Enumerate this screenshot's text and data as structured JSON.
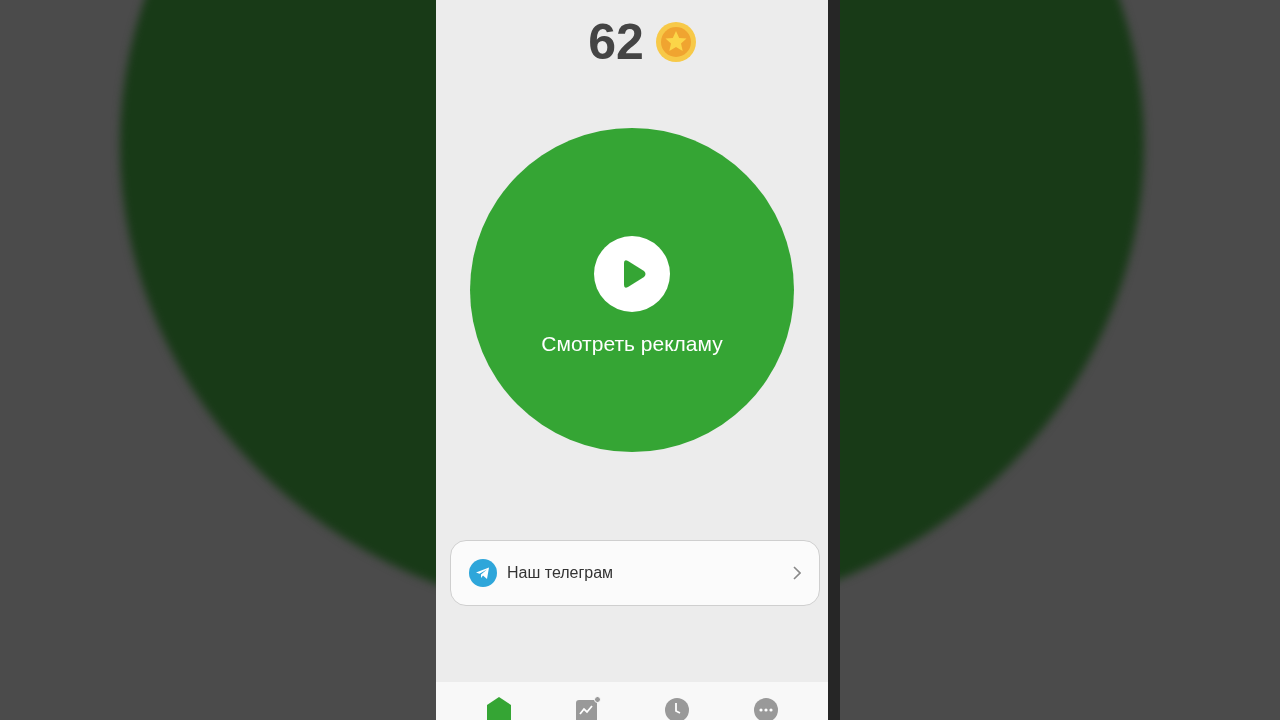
{
  "score": {
    "value": "62"
  },
  "ad_button": {
    "label": "Смотреть рекламу"
  },
  "links": [
    {
      "label": "Наш телеграм"
    }
  ],
  "nav": [
    {
      "kind": "home",
      "selected": true,
      "badge": false
    },
    {
      "kind": "stats",
      "selected": false,
      "badge": true
    },
    {
      "kind": "history",
      "selected": false,
      "badge": false
    },
    {
      "kind": "more",
      "selected": false,
      "badge": false
    }
  ]
}
